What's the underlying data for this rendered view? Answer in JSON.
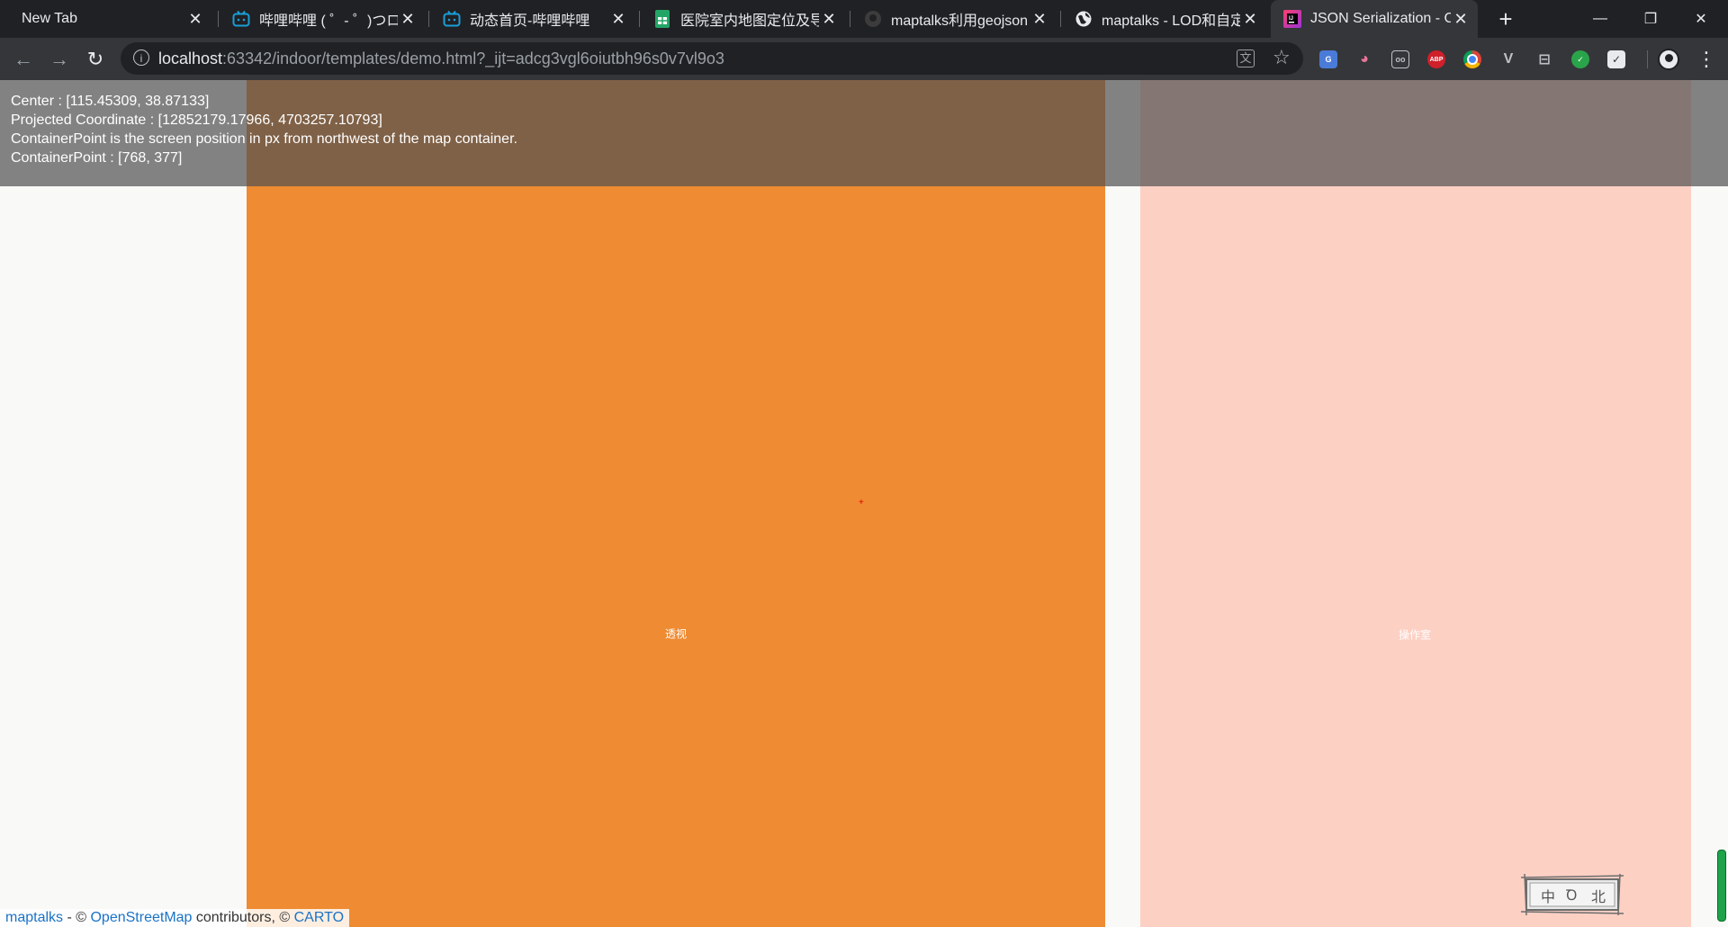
{
  "tabs": [
    {
      "title": "New Tab",
      "icon": "none",
      "active": false
    },
    {
      "title": "哔哩哔哩 ( ゜- ゜)つロ 干",
      "icon": "bilibili-icon",
      "active": false
    },
    {
      "title": "动态首页-哔哩哔哩",
      "icon": "bilibili-icon",
      "active": false
    },
    {
      "title": "医院室内地图定位及导",
      "icon": "sheets-icon",
      "active": false
    },
    {
      "title": "maptalks利用geojson",
      "icon": "github-icon",
      "active": false
    },
    {
      "title": "maptalks - LOD和自定",
      "icon": "globe-icon",
      "active": false
    },
    {
      "title": "JSON Serialization - C",
      "icon": "jetbrains-icon",
      "active": true
    }
  ],
  "tab_close_glyph": "✕",
  "new_tab_glyph": "+",
  "window_controls": {
    "minimize": "—",
    "restore": "❐",
    "close": "✕"
  },
  "toolbar": {
    "back_glyph": "←",
    "forward_glyph": "→",
    "reload_glyph": "↻",
    "url_host": "localhost",
    "url_rest": ":63342/indoor/templates/demo.html?_ijt=adcg3vgl6oiutbh96s0v7vl9o3",
    "star_glyph": "☆",
    "menu_glyph": "⋮",
    "extensions": [
      {
        "name": "google-translate-icon",
        "label": "G",
        "color": "#4a7bd9"
      },
      {
        "name": "cat-extension-icon",
        "label": "◕",
        "color": "#e9769a"
      },
      {
        "name": "reader-extension-icon",
        "label": "oo",
        "color": "#5f6368"
      },
      {
        "name": "adblock-plus-icon",
        "label": "ABP",
        "color": "#d0202a"
      },
      {
        "name": "chrome-extension-icon",
        "label": "",
        "color": "#f2b400"
      },
      {
        "name": "vue-devtools-icon",
        "label": "V",
        "color": "#8a8f95"
      },
      {
        "name": "screenshot-extension-icon",
        "label": "⊟",
        "color": "#5f6368"
      },
      {
        "name": "wechat-extension-icon",
        "label": "✓",
        "color": "#2aa44a"
      },
      {
        "name": "checkbox-extension-icon",
        "label": "✓",
        "color": "#5f6368"
      }
    ]
  },
  "map": {
    "info": {
      "center": "Center : [115.45309, 38.87133]",
      "projected": "Projected Coordinate : [12852179.17966, 4703257.10793]",
      "container_desc": "ContainerPoint is the screen position in px from northwest of the map container.",
      "container_point": "ContainerPoint : [768, 377]"
    },
    "rooms": [
      {
        "label": "透视",
        "color": "#ef8b32"
      },
      {
        "label": "操作室",
        "color": "#fdd0c4"
      }
    ],
    "center_marker": "+",
    "attribution": {
      "maptalks": "maptalks",
      "sep1": " - © ",
      "osm": "OpenStreetMap",
      "mid": " contributors, © ",
      "carto": "CARTO"
    },
    "compass_chars": [
      "中",
      "Ꝺ",
      "北"
    ]
  }
}
